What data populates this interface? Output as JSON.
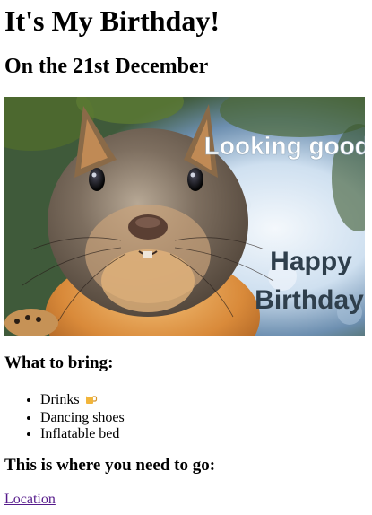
{
  "header": {
    "title": "It's My Birthday!",
    "date_line": "On the 21st December"
  },
  "photo": {
    "subject": "squirrel",
    "overlay_top": "Looking good!",
    "overlay_line1": "Happy",
    "overlay_line2": "Birthday",
    "overlay_color": "#2f3f4c"
  },
  "bring": {
    "heading": "What to bring:",
    "items": [
      {
        "label": "Drinks",
        "icon": "beer-mug-icon"
      },
      {
        "label": "Dancing shoes"
      },
      {
        "label": "Inflatable bed"
      }
    ]
  },
  "directions": {
    "heading": "This is where you need to go:",
    "link_label": "Location",
    "link_color": "#551a8b"
  }
}
